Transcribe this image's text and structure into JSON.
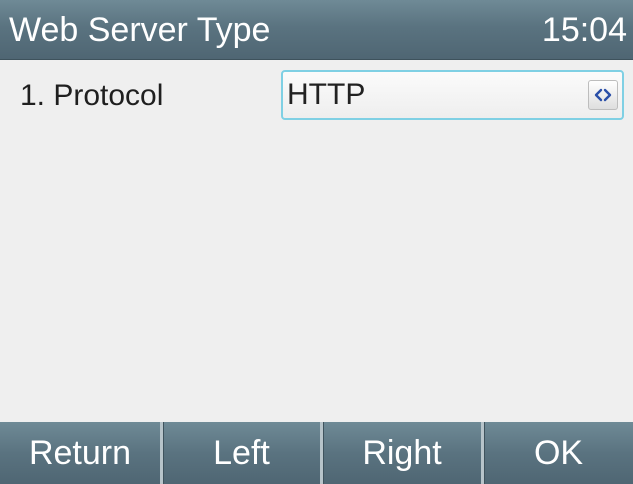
{
  "header": {
    "title": "Web Server Type",
    "time": "15:04"
  },
  "settings": {
    "rows": [
      {
        "label": "1. Protocol",
        "value": "HTTP",
        "control_icon": "left-right-arrows-icon"
      }
    ]
  },
  "softkeys": [
    {
      "label": "Return"
    },
    {
      "label": "Left"
    },
    {
      "label": "Right"
    },
    {
      "label": "OK"
    }
  ],
  "colors": {
    "bar_background": "#5a7380",
    "content_background": "#efefef",
    "focus_border": "#7fd0e4",
    "arrow_color": "#2a4fa8"
  }
}
